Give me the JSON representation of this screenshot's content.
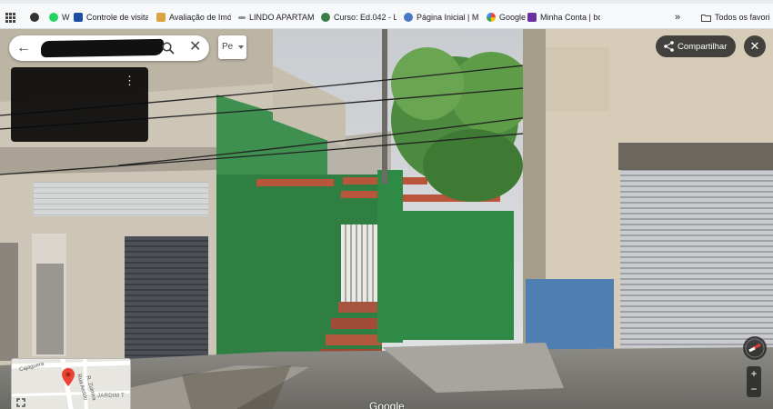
{
  "bookmarks_bar": {
    "items": [
      {
        "label": "",
        "icon": "apps-grid-icon"
      },
      {
        "label": "",
        "icon": "globe-icon"
      },
      {
        "label": "W",
        "icon": "whatsapp-icon"
      },
      {
        "label": "Controle de visitas |...",
        "icon": "doc-icon"
      },
      {
        "label": "Avaliação de Imóvei...",
        "icon": "house-icon"
      },
      {
        "label": "LINDO APARTAMEN...",
        "icon": "site-icon"
      },
      {
        "label": "Curso: Ed.042 - Loca...",
        "icon": "course-icon"
      },
      {
        "label": "Página Inicial | Micr...",
        "icon": "gear-icon"
      },
      {
        "label": "Google",
        "icon": "google-icon"
      },
      {
        "label": "Minha Conta | bom...",
        "icon": "account-icon"
      }
    ],
    "more": "»",
    "all_favorites": "Todos os favoritos"
  },
  "search": {
    "value": ""
  },
  "pegman_label": "Pe",
  "share_label": "Compartilhar",
  "close_symbol": "✕",
  "minimap": {
    "streets": [
      "Cajaguera",
      "Rua Aroldo",
      "R. Zulmira"
    ],
    "district": "JARDIM T"
  },
  "zoom": {
    "in": "+",
    "out": "−"
  },
  "google_logo": "Google"
}
